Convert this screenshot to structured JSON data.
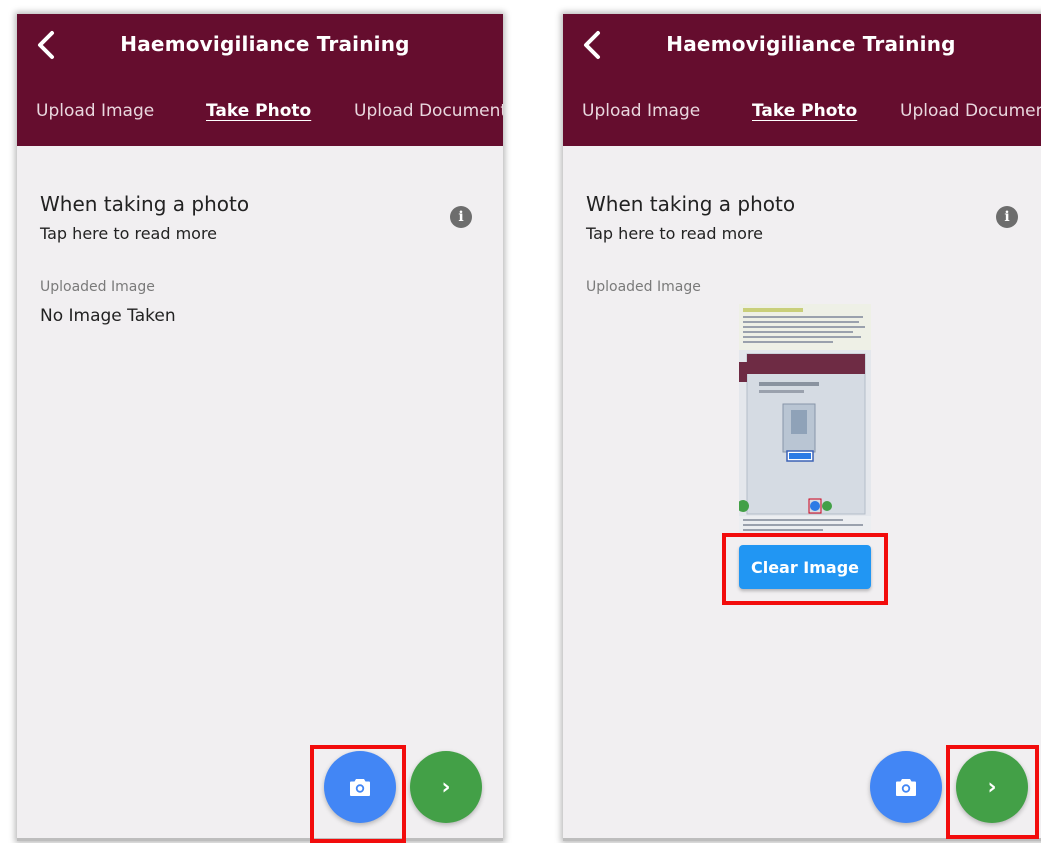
{
  "screens": [
    {
      "app_title": "Haemovigiliance Training",
      "tabs": [
        "Upload Image",
        "Take Photo",
        "Upload Document"
      ],
      "active_tab": "Take Photo",
      "info_title": "When taking a photo",
      "info_subtitle": "Tap here to read more",
      "info_icon": "info-icon",
      "uploaded_label": "Uploaded Image",
      "image_status": "No Image Taken",
      "fab_camera_icon": "camera-icon",
      "fab_next_glyph": "›"
    },
    {
      "app_title": "Haemovigiliance Training",
      "tabs": [
        "Upload Image",
        "Take Photo",
        "Upload Document"
      ],
      "active_tab": "Take Photo",
      "info_title": "When taking a photo",
      "info_subtitle": "Tap here to read more",
      "info_icon": "info-icon",
      "uploaded_label": "Uploaded Image",
      "clear_button": "Clear Image",
      "fab_camera_icon": "camera-icon",
      "fab_next_glyph": "›"
    }
  ],
  "colors": {
    "app_bar": "#650d2e",
    "background": "#f1eff1",
    "clear_button": "#2196f3",
    "fab_camera": "#4286f5",
    "fab_next": "#43a047",
    "highlight": "#f20c0c"
  }
}
